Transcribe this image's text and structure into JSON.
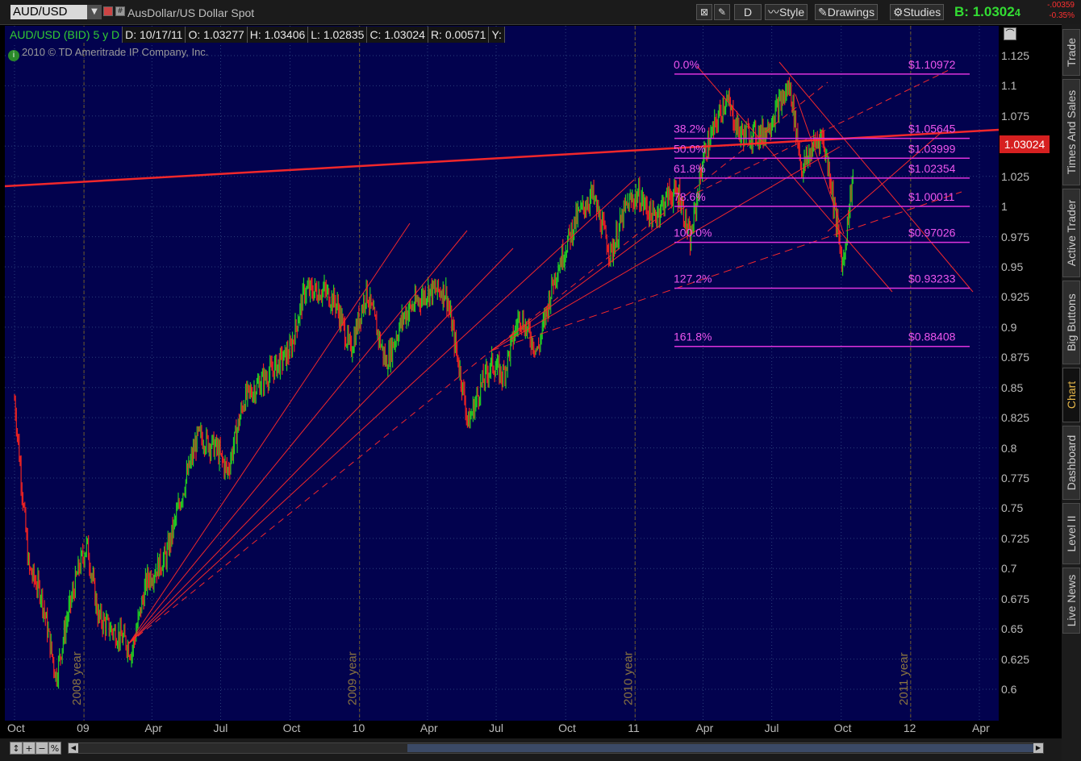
{
  "toolbar": {
    "symbol": "AUD/USD",
    "description": "AusDollar/US Dollar Spot",
    "period_button": "D",
    "style_label": "Style",
    "drawings_label": "Drawings",
    "studies_label": "Studies",
    "bid_label": "B:",
    "bid_price": "1.0302",
    "bid_price_tail": "4",
    "change_abs": "-.00359",
    "change_pct": "-0.35%"
  },
  "info_bar": {
    "symbol_label": "AUD/USD (BID) 5 y D",
    "date": "D: 10/17/11",
    "open": "O: 1.03277",
    "high": "H: 1.03406",
    "low": "L: 1.02835",
    "close": "C: 1.03024",
    "range": "R: 0.00571",
    "y": "Y:"
  },
  "copyright": "2010 © TD Ameritrade IP Company, Inc.",
  "current_price_label": "1.03024",
  "colors": {
    "background": "#02024e",
    "up_bar": "#22cc22",
    "down_bar": "#ee2222",
    "trendline": "#ff2a2a",
    "fib": "#dd33dd",
    "fib_text": "#ee55ee"
  },
  "chart_data": {
    "type": "candlestick",
    "title": "AUD/USD (BID) 5 y D",
    "ylim": [
      0.59,
      1.135
    ],
    "y_ticks": [
      "1.125",
      "1.1",
      "1.075",
      "1.05",
      "1.025",
      "1",
      "0.975",
      "0.95",
      "0.925",
      "0.9",
      "0.875",
      "0.85",
      "0.825",
      "0.8",
      "0.775",
      "0.75",
      "0.725",
      "0.7",
      "0.675",
      "0.65",
      "0.625",
      "0.6"
    ],
    "x_ticks": [
      "Oct",
      "09",
      "Apr",
      "Jul",
      "Oct",
      "10",
      "Apr",
      "Jul",
      "Oct",
      "11",
      "Apr",
      "Jul",
      "Oct",
      "12",
      "Apr"
    ],
    "year_markers": [
      "2008 year",
      "2009 year",
      "2010 year",
      "2011 year"
    ],
    "price_path": [
      [
        "2008-10-01",
        0.84
      ],
      [
        "2008-10-20",
        0.7
      ],
      [
        "2008-11-05",
        0.68
      ],
      [
        "2008-11-25",
        0.61
      ],
      [
        "2008-12-10",
        0.66
      ],
      [
        "2008-12-25",
        0.7
      ],
      [
        "2009-01-05",
        0.72
      ],
      [
        "2009-01-20",
        0.66
      ],
      [
        "2009-02-05",
        0.65
      ],
      [
        "2009-02-25",
        0.64
      ],
      [
        "2009-03-05",
        0.63
      ],
      [
        "2009-03-25",
        0.69
      ],
      [
        "2009-04-20",
        0.71
      ],
      [
        "2009-05-10",
        0.76
      ],
      [
        "2009-06-01",
        0.81
      ],
      [
        "2009-06-25",
        0.8
      ],
      [
        "2009-07-10",
        0.78
      ],
      [
        "2009-08-01",
        0.84
      ],
      [
        "2009-09-01",
        0.86
      ],
      [
        "2009-10-01",
        0.88
      ],
      [
        "2009-10-20",
        0.93
      ],
      [
        "2009-11-15",
        0.93
      ],
      [
        "2009-12-01",
        0.92
      ],
      [
        "2009-12-20",
        0.88
      ],
      [
        "2010-01-10",
        0.93
      ],
      [
        "2010-02-05",
        0.87
      ],
      [
        "2010-03-01",
        0.91
      ],
      [
        "2010-04-01",
        0.93
      ],
      [
        "2010-04-25",
        0.93
      ],
      [
        "2010-05-15",
        0.86
      ],
      [
        "2010-05-25",
        0.82
      ],
      [
        "2010-06-10",
        0.85
      ],
      [
        "2010-06-25",
        0.87
      ],
      [
        "2010-07-10",
        0.86
      ],
      [
        "2010-08-01",
        0.91
      ],
      [
        "2010-08-25",
        0.88
      ],
      [
        "2010-09-15",
        0.94
      ],
      [
        "2010-10-15",
        0.99
      ],
      [
        "2010-11-05",
        1.01
      ],
      [
        "2010-11-30",
        0.96
      ],
      [
        "2010-12-20",
        1.0
      ],
      [
        "2011-01-05",
        1.01
      ],
      [
        "2011-01-25",
        0.99
      ],
      [
        "2011-02-15",
        1.01
      ],
      [
        "2011-03-01",
        1.01
      ],
      [
        "2011-03-15",
        0.97
      ],
      [
        "2011-04-01",
        1.04
      ],
      [
        "2011-05-01",
        1.09
      ],
      [
        "2011-05-20",
        1.06
      ],
      [
        "2011-06-20",
        1.06
      ],
      [
        "2011-07-25",
        1.1
      ],
      [
        "2011-08-10",
        1.03
      ],
      [
        "2011-08-25",
        1.05
      ],
      [
        "2011-09-05",
        1.06
      ],
      [
        "2011-09-15",
        1.03
      ],
      [
        "2011-10-03",
        0.95
      ],
      [
        "2011-10-17",
        1.03024
      ]
    ],
    "fibonacci": [
      {
        "label": "0.0%",
        "price_label": "$1.10972",
        "value": 1.10972
      },
      {
        "label": "38.2%",
        "price_label": "$1.05645",
        "value": 1.05645
      },
      {
        "label": "50.0%",
        "price_label": "$1.03999",
        "value": 1.03999
      },
      {
        "label": "61.8%",
        "price_label": "$1.02354",
        "value": 1.02354
      },
      {
        "label": "78.6%",
        "price_label": "$1.00011",
        "value": 1.00011
      },
      {
        "label": "100.0%",
        "price_label": "$0.97026",
        "value": 0.97026
      },
      {
        "label": "127.2%",
        "price_label": "$0.93233",
        "value": 0.93233
      },
      {
        "label": "161.8%",
        "price_label": "$0.88408",
        "value": 0.88408
      }
    ]
  },
  "side_tabs": [
    "Trade",
    "Times And Sales",
    "Active Trader",
    "Big Buttons",
    "Chart",
    "Dashboard",
    "Level II",
    "Live News"
  ],
  "side_tabs_active": "Chart",
  "bottom": {
    "zoom_pct_icon": "%"
  }
}
